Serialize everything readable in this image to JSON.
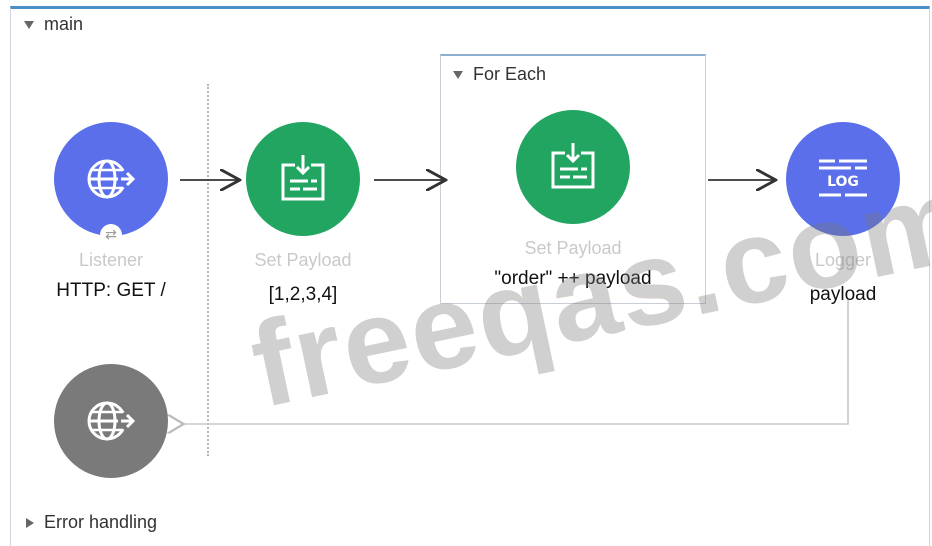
{
  "flow": {
    "main_label": "main",
    "error_handling_label": "Error handling"
  },
  "for_each": {
    "label": "For Each"
  },
  "nodes": {
    "listener": {
      "title": "Listener",
      "subtitle": "HTTP: GET /",
      "icon": "globe-icon",
      "color": "#5a6fe9"
    },
    "set_payload_1": {
      "title": "Set Payload",
      "subtitle": "[1,2,3,4]",
      "icon": "set-payload-icon",
      "color": "#21a560"
    },
    "set_payload_2": {
      "title": "Set Payload",
      "subtitle": "\"order\" ++ payload",
      "icon": "set-payload-icon",
      "color": "#21a560"
    },
    "logger": {
      "title": "Logger",
      "subtitle": "payload",
      "icon": "log-icon",
      "color": "#5a6fe9"
    },
    "response": {
      "icon": "globe-icon",
      "color": "#7a7a7a"
    }
  },
  "watermark": {
    "text": "freeqas.com"
  }
}
